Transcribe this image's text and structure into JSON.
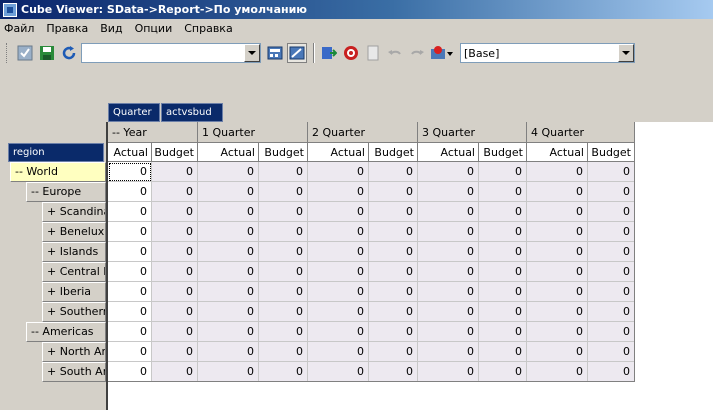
{
  "window": {
    "title": "Cube Viewer: SData->Report->По умолчанию"
  },
  "menu": [
    "Файл",
    "Правка",
    "Вид",
    "Опции",
    "Справка"
  ],
  "toolbar": {
    "subset_value": "",
    "view_value": "[Base]"
  },
  "column_dims": {
    "dim1": "Quarter",
    "dim2": "actvsbud"
  },
  "row_dim": "region",
  "columns": {
    "groups": [
      "-- Year",
      "1 Quarter",
      "2 Quarter",
      "3 Quarter",
      "4 Quarter"
    ],
    "subs": [
      "Actual",
      "Budget"
    ]
  },
  "rows": [
    {
      "label": "-- World"
    },
    {
      "label": "-- Europe"
    },
    {
      "label": "+ Scandinavia"
    },
    {
      "label": "+ Benelux"
    },
    {
      "label": "+ Islands"
    },
    {
      "label": "+ Central Europe"
    },
    {
      "label": "+ Iberia"
    },
    {
      "label": "+ Southern Europe"
    },
    {
      "label": "-- Americas"
    },
    {
      "label": "+ North America"
    },
    {
      "label": "+ South America"
    }
  ],
  "cell_value": "0",
  "colors": {
    "title_bar": "#0a246a",
    "dim_tile": "#0a2a6a",
    "selected_row_header": "#ffffc0",
    "cell_bg": "#ede9f0"
  }
}
